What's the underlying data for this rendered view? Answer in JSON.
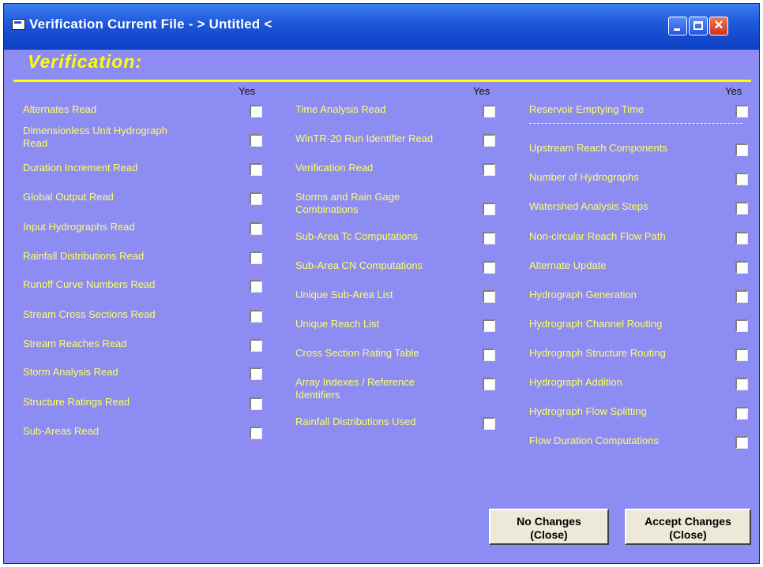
{
  "window": {
    "title": "Verification  Current File - > Untitled <"
  },
  "heading": "Verification:",
  "column_header": "Yes",
  "columns": [
    {
      "items": [
        {
          "label_lines": [
            "Alternates Read"
          ],
          "checked": false
        },
        {
          "label_lines": [
            "Dimensionless  Unit  Hydrograph",
            "Read"
          ],
          "checked": false
        },
        {
          "label_lines": [
            "Duration Increment Read"
          ],
          "checked": false
        },
        {
          "label_lines": [
            "Global Output Read"
          ],
          "checked": false
        },
        {
          "label_lines": [
            "Input Hydrographs Read"
          ],
          "checked": false
        },
        {
          "label_lines": [
            "Rainfall Distributions Read"
          ],
          "checked": false
        },
        {
          "label_lines": [
            "Runoff Curve Numbers Read"
          ],
          "checked": false
        },
        {
          "label_lines": [
            "Stream Cross Sections Read"
          ],
          "checked": false
        },
        {
          "label_lines": [
            "Stream Reaches Read"
          ],
          "checked": false
        },
        {
          "label_lines": [
            "Storm Analysis Read"
          ],
          "checked": false
        },
        {
          "label_lines": [
            "Structure Ratings Read"
          ],
          "checked": false
        },
        {
          "label_lines": [
            "Sub-Areas Read"
          ],
          "checked": false
        }
      ]
    },
    {
      "items": [
        {
          "label_lines": [
            "Time Analysis Read"
          ],
          "checked": false
        },
        {
          "label_lines": [
            "WinTR-20 Run Identifier Read"
          ],
          "checked": false
        },
        {
          "label_lines": [
            "Verification  Read"
          ],
          "checked": false
        },
        {
          "label_lines": [
            "Storms and Rain Gage",
            "Combinations"
          ],
          "checked": false
        },
        {
          "label_lines": [
            "Sub-Area Tc Computations"
          ],
          "checked": false
        },
        {
          "label_lines": [
            "Sub-Area CN Computations"
          ],
          "checked": false
        },
        {
          "label_lines": [
            "Unique Sub-Area List"
          ],
          "checked": false
        },
        {
          "label_lines": [
            "Unique Reach List"
          ],
          "checked": false
        },
        {
          "label_lines": [
            "Cross Section Rating Table"
          ],
          "checked": false
        },
        {
          "label_lines": [
            "Array Indexes / Reference",
            "Identifiers"
          ],
          "checked": false
        },
        {
          "label_lines": [
            "Rainfall Distributions Used"
          ],
          "checked": false
        }
      ]
    },
    {
      "items": [
        {
          "label_lines": [
            "Reservoir Emptying Time"
          ],
          "checked": false
        },
        {
          "label_lines": [
            "Upstream Reach Components"
          ],
          "checked": false
        },
        {
          "label_lines": [
            "Number of Hydrographs"
          ],
          "checked": false
        },
        {
          "label_lines": [
            "Watershed  Analysis Steps"
          ],
          "checked": false
        },
        {
          "label_lines": [
            "Non-circular Reach Flow Path"
          ],
          "checked": false
        },
        {
          "label_lines": [
            "Alternate Update"
          ],
          "checked": false
        },
        {
          "label_lines": [
            "Hydrograph Generation"
          ],
          "checked": false
        },
        {
          "label_lines": [
            "Hydrograph Channel Routing"
          ],
          "checked": false
        },
        {
          "label_lines": [
            "Hydrograph Structure Routing"
          ],
          "checked": false
        },
        {
          "label_lines": [
            "Hydrograph Addition"
          ],
          "checked": false
        },
        {
          "label_lines": [
            "Hydrograph Flow Splitting"
          ],
          "checked": false
        },
        {
          "label_lines": [
            "Flow Duration Computations"
          ],
          "checked": false
        }
      ]
    }
  ],
  "buttons": {
    "no_changes": {
      "line1": "No Changes",
      "line2": "(Close)"
    },
    "accept_changes": {
      "line1": "Accept Changes",
      "line2": "(Close)"
    }
  },
  "colors": {
    "background": "#8c8cf2",
    "label_text": "#ffff66",
    "heading": "#ffff00",
    "titlebar": "#1d56d8"
  }
}
